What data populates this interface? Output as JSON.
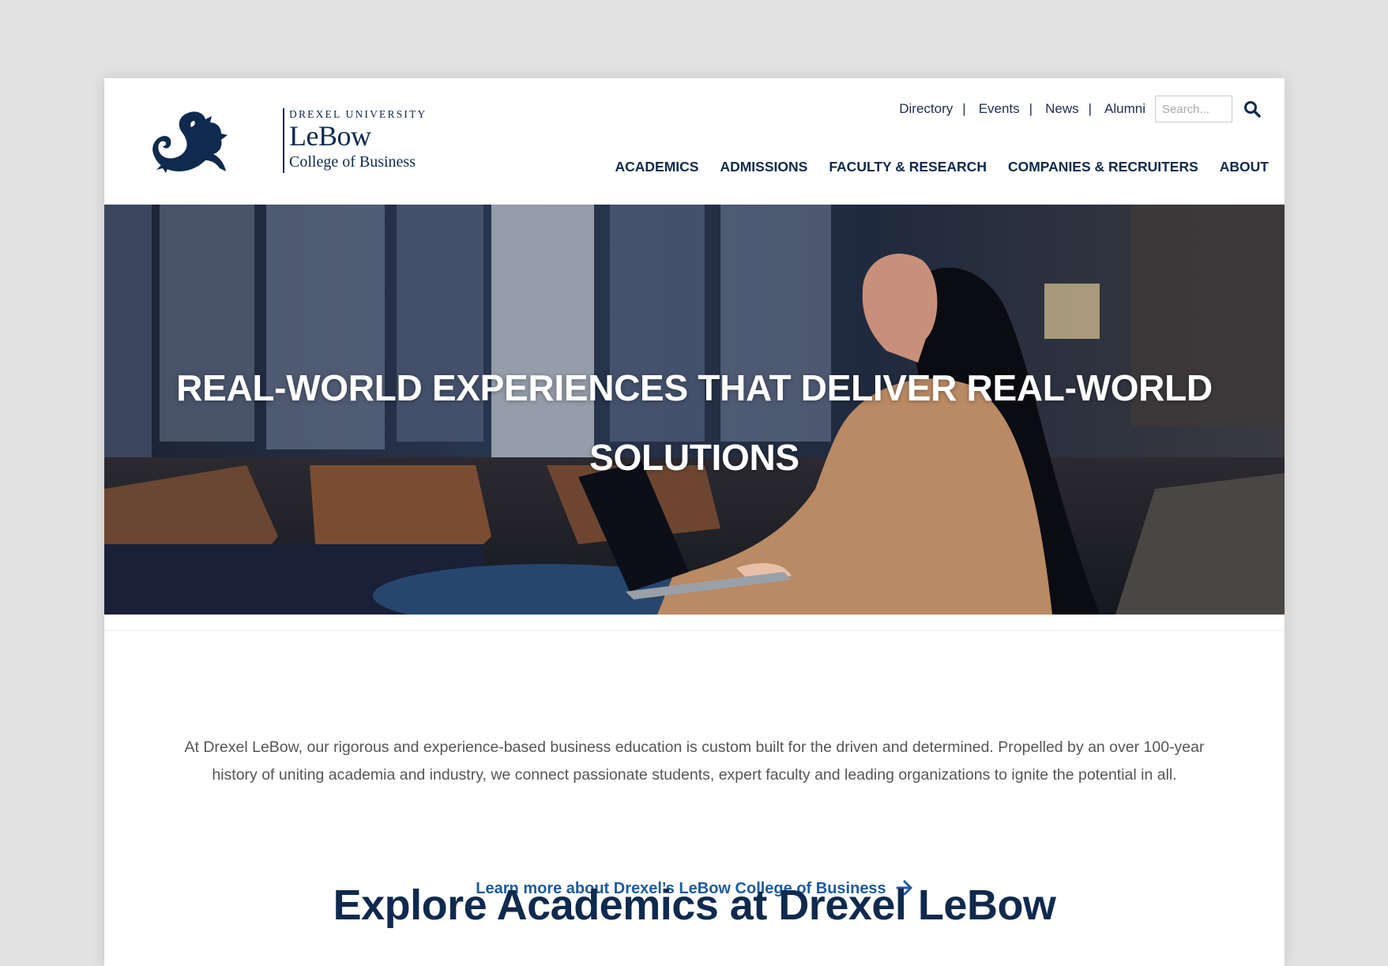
{
  "colors": {
    "brand_navy": "#0f2a4e",
    "link_blue": "#1e5b9a",
    "body_text": "#555555",
    "background": "#e2e2e2"
  },
  "logo": {
    "university": "DREXEL UNIVERSITY",
    "name": "LeBow",
    "college": "College of Business",
    "icon": "dragon-icon"
  },
  "utility_nav": {
    "links": [
      "Directory",
      "Events",
      "News",
      "Alumni"
    ],
    "search_placeholder": "Search...",
    "search_icon": "search-icon"
  },
  "main_nav": {
    "items": [
      "ACADEMICS",
      "ADMISSIONS",
      "FACULTY & RESEARCH",
      "COMPANIES & RECRUITERS",
      "ABOUT"
    ]
  },
  "hero": {
    "title_line1": "REAL-WORLD EXPERIENCES THAT DELIVER REAL-WORLD",
    "title_line2": "SOLUTIONS"
  },
  "intro": {
    "text": "At Drexel LeBow, our rigorous and experience-based business education is custom built for the driven and determined. Propelled by an over 100-year history of uniting academia and industry, we connect passionate students, expert faculty and leading organizations to ignite the potential in all.",
    "link_label": "Learn more about Drexel’s LeBow College of Business",
    "link_icon": "arrow-right-icon"
  },
  "section": {
    "heading": "Explore Academics at Drexel LeBow"
  }
}
